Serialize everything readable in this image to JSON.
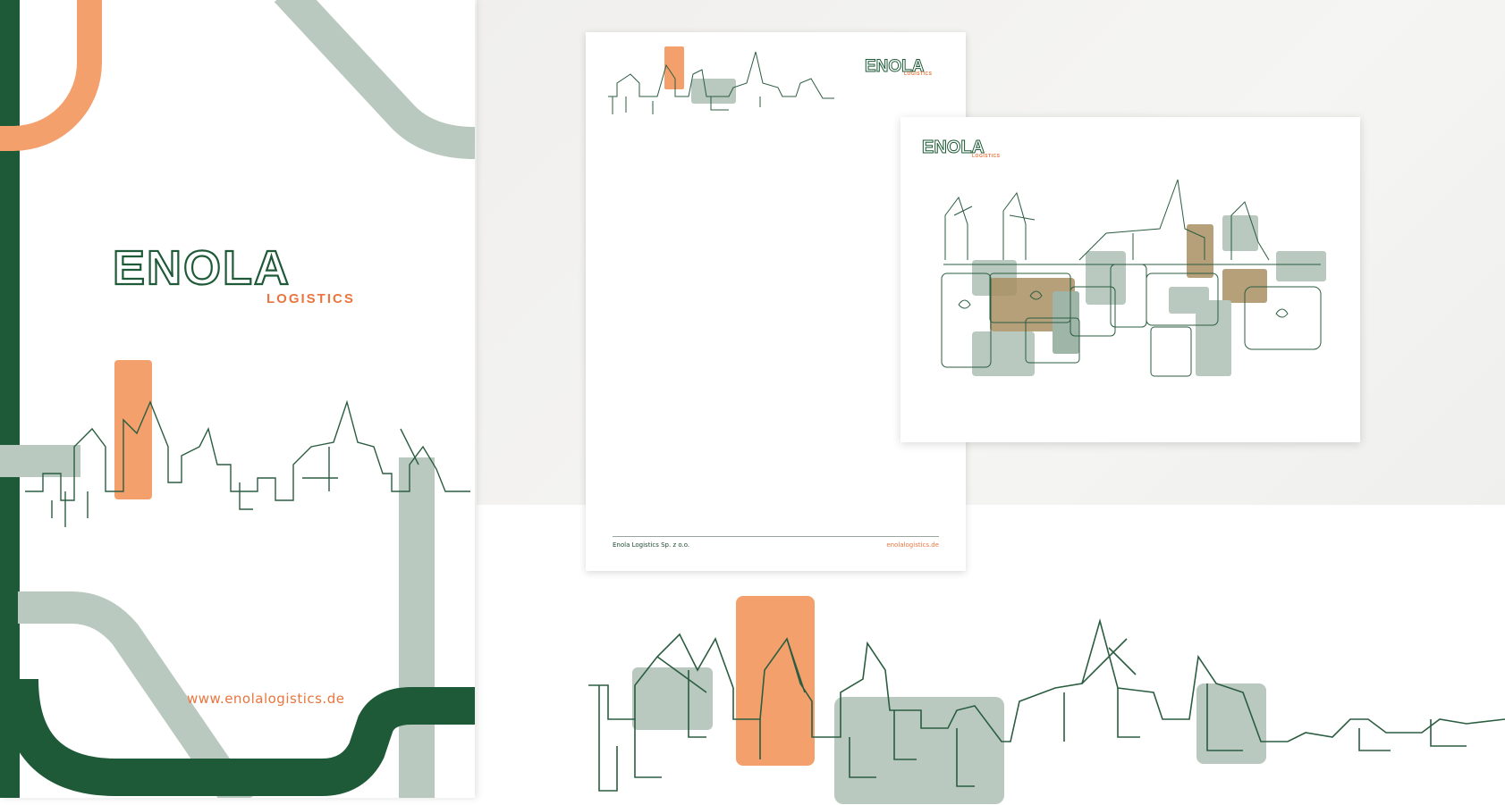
{
  "brand": {
    "name": "ENOLA",
    "sub": "LOGISTICS",
    "url": "www.enolalogistics.de",
    "company": "Enola Logistics Sp. z o.o.",
    "domain": "enolalogistics.de"
  },
  "colors": {
    "dark_green": "#1e5a37",
    "sage": "#b9c9bf",
    "orange": "#f4a06c",
    "gold": "#a88f63",
    "line_green": "#2b5d41"
  },
  "icons": [
    "skyline-crane-illustration",
    "gift-box-illustration"
  ]
}
